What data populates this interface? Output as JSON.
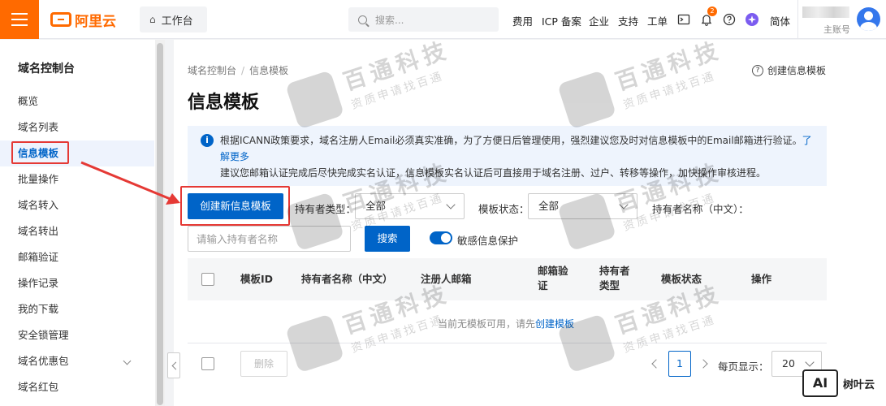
{
  "topbar": {
    "logo_text": "阿里云",
    "workbench_label": "工作台",
    "search_placeholder": "搜索...",
    "nav": [
      "费用",
      "ICP 备案",
      "企业",
      "支持",
      "工单"
    ],
    "notification_count": "2",
    "language": "简体",
    "account_sub": "主账号"
  },
  "sidebar": {
    "title": "域名控制台",
    "items": [
      {
        "label": "概览"
      },
      {
        "label": "域名列表"
      },
      {
        "label": "信息模板"
      },
      {
        "label": "批量操作"
      },
      {
        "label": "域名转入"
      },
      {
        "label": "域名转出"
      },
      {
        "label": "邮箱验证"
      },
      {
        "label": "操作记录"
      },
      {
        "label": "我的下载"
      },
      {
        "label": "安全锁管理"
      },
      {
        "label": "域名优惠包"
      },
      {
        "label": "域名红包"
      }
    ],
    "active_index": 2
  },
  "main": {
    "breadcrumb": [
      "域名控制台",
      "信息模板"
    ],
    "help_link": "创建信息模板",
    "title": "信息模板",
    "notice": {
      "line1": "根据ICANN政策要求，域名注册人Email必须真实准确，为了方便日后管理使用，强烈建议您及时对信息模板中的Email邮箱进行验证。",
      "link": "了解更多",
      "line2": "建议您邮箱认证完成后尽快完成实名认证，信息模板实名认证后可直接用于域名注册、过户、转移等操作，加快操作审核进程。"
    },
    "create_button": "创建新信息模板",
    "filters": {
      "holder_type_label": "持有者类型：",
      "holder_type_value": "全部",
      "status_label": "模板状态：",
      "status_value": "全部",
      "holder_name_label": "持有者名称（中文）：",
      "holder_name_placeholder": "请输入持有者名称",
      "search_button": "搜索",
      "sensitive_toggle_label": "敏感信息保护"
    },
    "table": {
      "columns": [
        "模板ID",
        "持有者名称（中文）",
        "注册人邮箱",
        "邮箱验\n证",
        "持有者\n类型",
        "模板状态",
        "操作"
      ],
      "empty_text": "当前无模板可用，请先",
      "empty_link": "创建模板"
    },
    "footer": {
      "delete_button": "删除",
      "current_page": "1",
      "per_page_label": "每页显示：",
      "per_page_value": "20"
    }
  },
  "watermark": {
    "title": "百通科技",
    "subtitle": "资质申请找百通"
  },
  "brand": {
    "badge": "AI",
    "name": "树叶云"
  },
  "colors": {
    "accent": "#ff6a00",
    "primary": "#0064c8",
    "highlight": "#e53935"
  }
}
